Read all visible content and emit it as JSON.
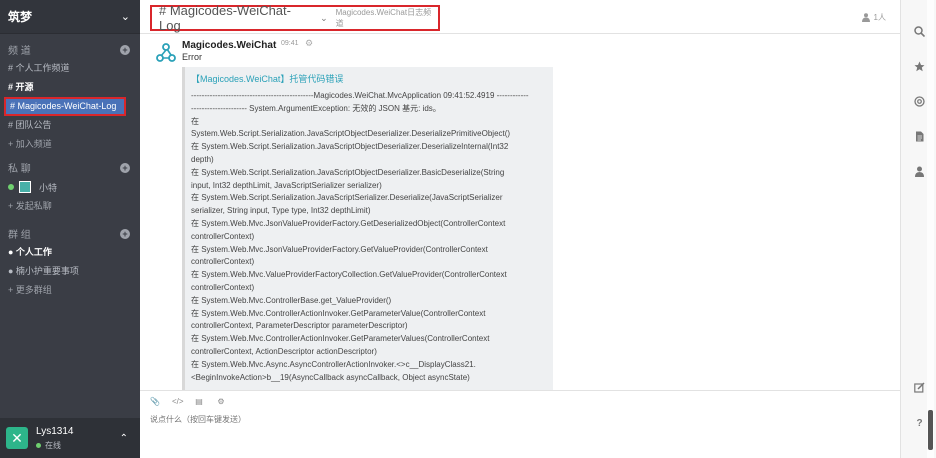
{
  "sidebar": {
    "team_name": "筑梦",
    "channels_header": "频 道",
    "channels": [
      "# 个人工作频道",
      "# 开源",
      "# Magicodes-WeiChat-Log",
      "# 团队公告"
    ],
    "join_channel": "+ 加入频道",
    "dm_header": "私 聊",
    "dm_user": "小特",
    "start_dm": "+ 发起私聊",
    "groups_header": "群 组",
    "groups": [
      "● 个人工作",
      "● 楠小护重要事项"
    ],
    "more_groups": "+ 更多群组"
  },
  "user": {
    "name": "Lys1314",
    "status": "在线"
  },
  "header": {
    "channel_title": "# Magicodes-WeiChat-Log",
    "channel_desc": "Magicodes.WeiChat日志频道",
    "member_count": "1人"
  },
  "message": {
    "author": "Magicodes.WeiChat",
    "time": "09:41",
    "text": "Error",
    "attachment_title": "【Magicodes.WeiChat】托管代码错误",
    "trace": [
      "----------------------------------------------Magicodes.WeiChat.MvcApplication 09:41:52.4919 ------------",
      "--------------------- System.ArgumentException: 无效的 JSON 基元: ids。",
      "在",
      "System.Web.Script.Serialization.JavaScriptObjectDeserializer.DeserializePrimitiveObject()",
      "在 System.Web.Script.Serialization.JavaScriptObjectDeserializer.DeserializeInternal(Int32",
      "depth)",
      "在 System.Web.Script.Serialization.JavaScriptObjectDeserializer.BasicDeserialize(String",
      "input, Int32 depthLimit, JavaScriptSerializer serializer)",
      "在 System.Web.Script.Serialization.JavaScriptSerializer.Deserialize(JavaScriptSerializer",
      "serializer, String input, Type type, Int32 depthLimit)",
      "在 System.Web.Mvc.JsonValueProviderFactory.GetDeserializedObject(ControllerContext",
      "controllerContext)",
      "在 System.Web.Mvc.JsonValueProviderFactory.GetValueProvider(ControllerContext",
      "controllerContext)",
      "在 System.Web.Mvc.ValueProviderFactoryCollection.GetValueProvider(ControllerContext",
      "controllerContext)",
      "在 System.Web.Mvc.ControllerBase.get_ValueProvider()",
      "在 System.Web.Mvc.ControllerActionInvoker.GetParameterValue(ControllerContext",
      "controllerContext, ParameterDescriptor parameterDescriptor)",
      "在 System.Web.Mvc.ControllerActionInvoker.GetParameterValues(ControllerContext",
      "controllerContext, ActionDescriptor actionDescriptor)",
      "在 System.Web.Mvc.Async.AsyncControllerActionInvoker.<>c__DisplayClass21.",
      "<BeginInvokeAction>b__19(AsyncCallback asyncCallback, Object asyncState)"
    ]
  },
  "composer": {
    "placeholder": "说点什么（按回车键发送）"
  },
  "icons": {
    "rail": [
      "search-icon",
      "star-icon",
      "at-icon",
      "file-icon",
      "person-icon",
      "edit-icon",
      "help-icon"
    ],
    "toolbar": [
      "paperclip-icon",
      "code-icon",
      "document-icon",
      "gear-icon"
    ]
  },
  "colors": {
    "sidebar_bg": "#3a3d45",
    "active_channel": "#4a72b8",
    "highlight_box": "#d9262b",
    "attachment_title": "#2aa1b8",
    "online": "#6fd06f"
  }
}
